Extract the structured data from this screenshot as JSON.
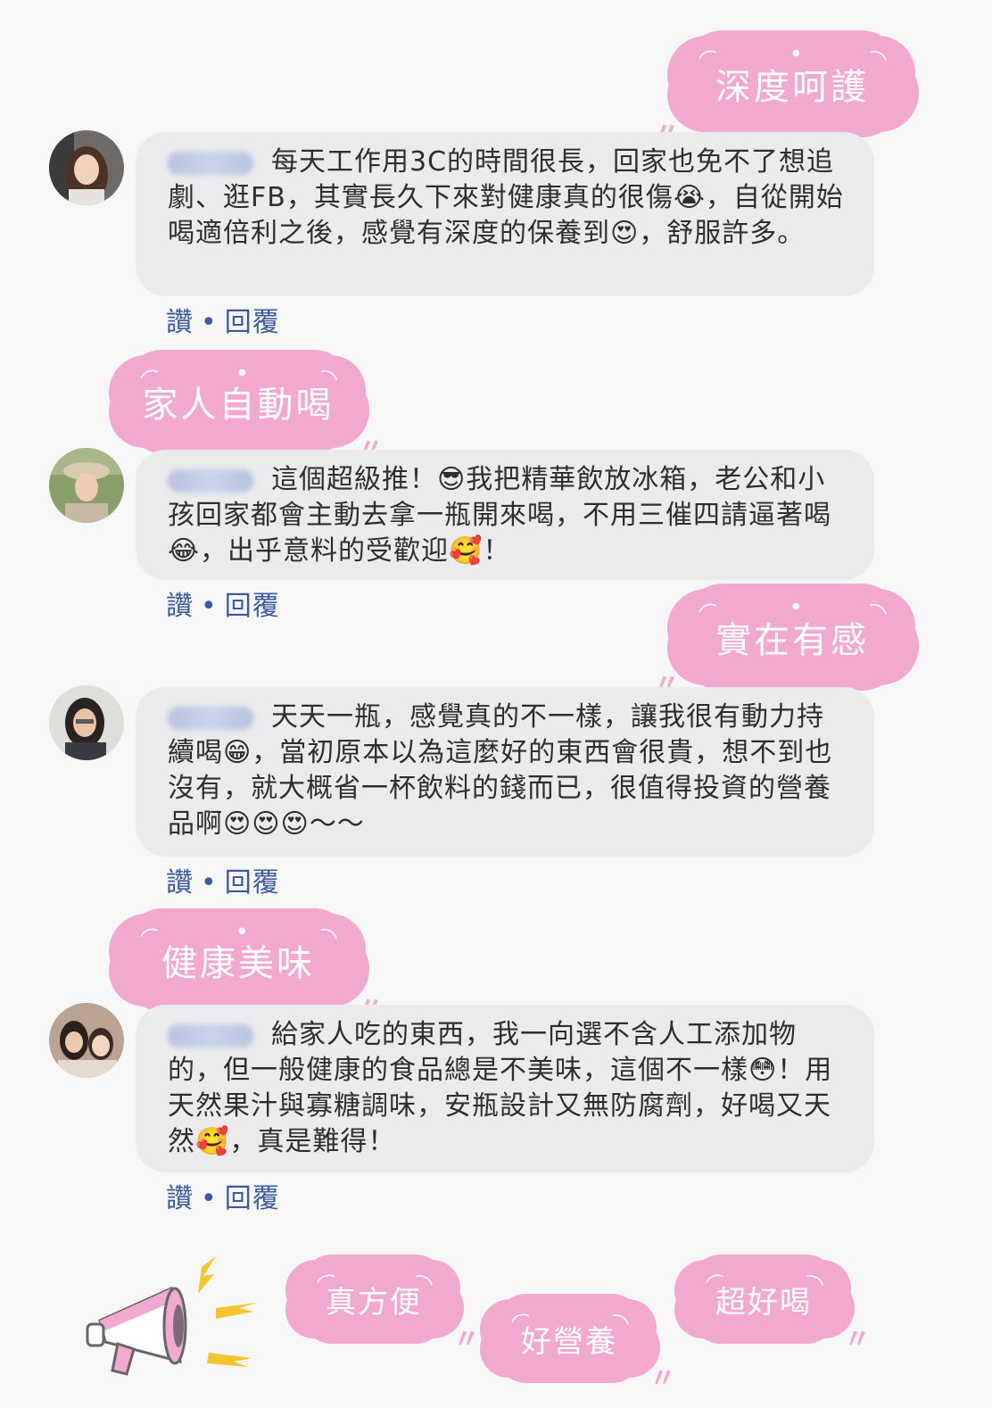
{
  "tags": {
    "tag1": "深度呵護",
    "tag2": "家人自動喝",
    "tag3": "實在有感",
    "tag4": "健康美味",
    "bottom1": "真方便",
    "bottom2": "好營養",
    "bottom3": "超好喝"
  },
  "comments": [
    {
      "text": "每天工作用3C的時間很長，回家也免不了想追劇、逛FB，其實長久下來對健康真的很傷😭，自從開始喝適倍利之後，感覺有深度的保養到😍，舒服許多。"
    },
    {
      "text": "這個超級推！😎我把精華飲放冰箱，老公和小孩回家都會主動去拿一瓶開來喝，不用三催四請逼著喝😂，出乎意料的受歡迎🥰！"
    },
    {
      "text": "天天一瓶，感覺真的不一樣，讓我很有動力持續喝😁，當初原本以為這麼好的東西會很貴，想不到也沒有，就大概省一杯飲料的錢而已，很值得投資的營養品啊😍😍😍～～"
    },
    {
      "text": "給家人吃的東西，我一向選不含人工添加物的，但一般健康的食品總是不美味，這個不一樣😳！用天然果汁與寡糖調味，安瓶設計又無防腐劑，好喝又天然🥰，真是難得！"
    }
  ],
  "actions": {
    "like": "讚",
    "separator": "•",
    "reply": "回覆"
  },
  "colors": {
    "cloud": "#f2a9cf",
    "bubble": "#ebebed",
    "action": "#3d5a9e"
  }
}
